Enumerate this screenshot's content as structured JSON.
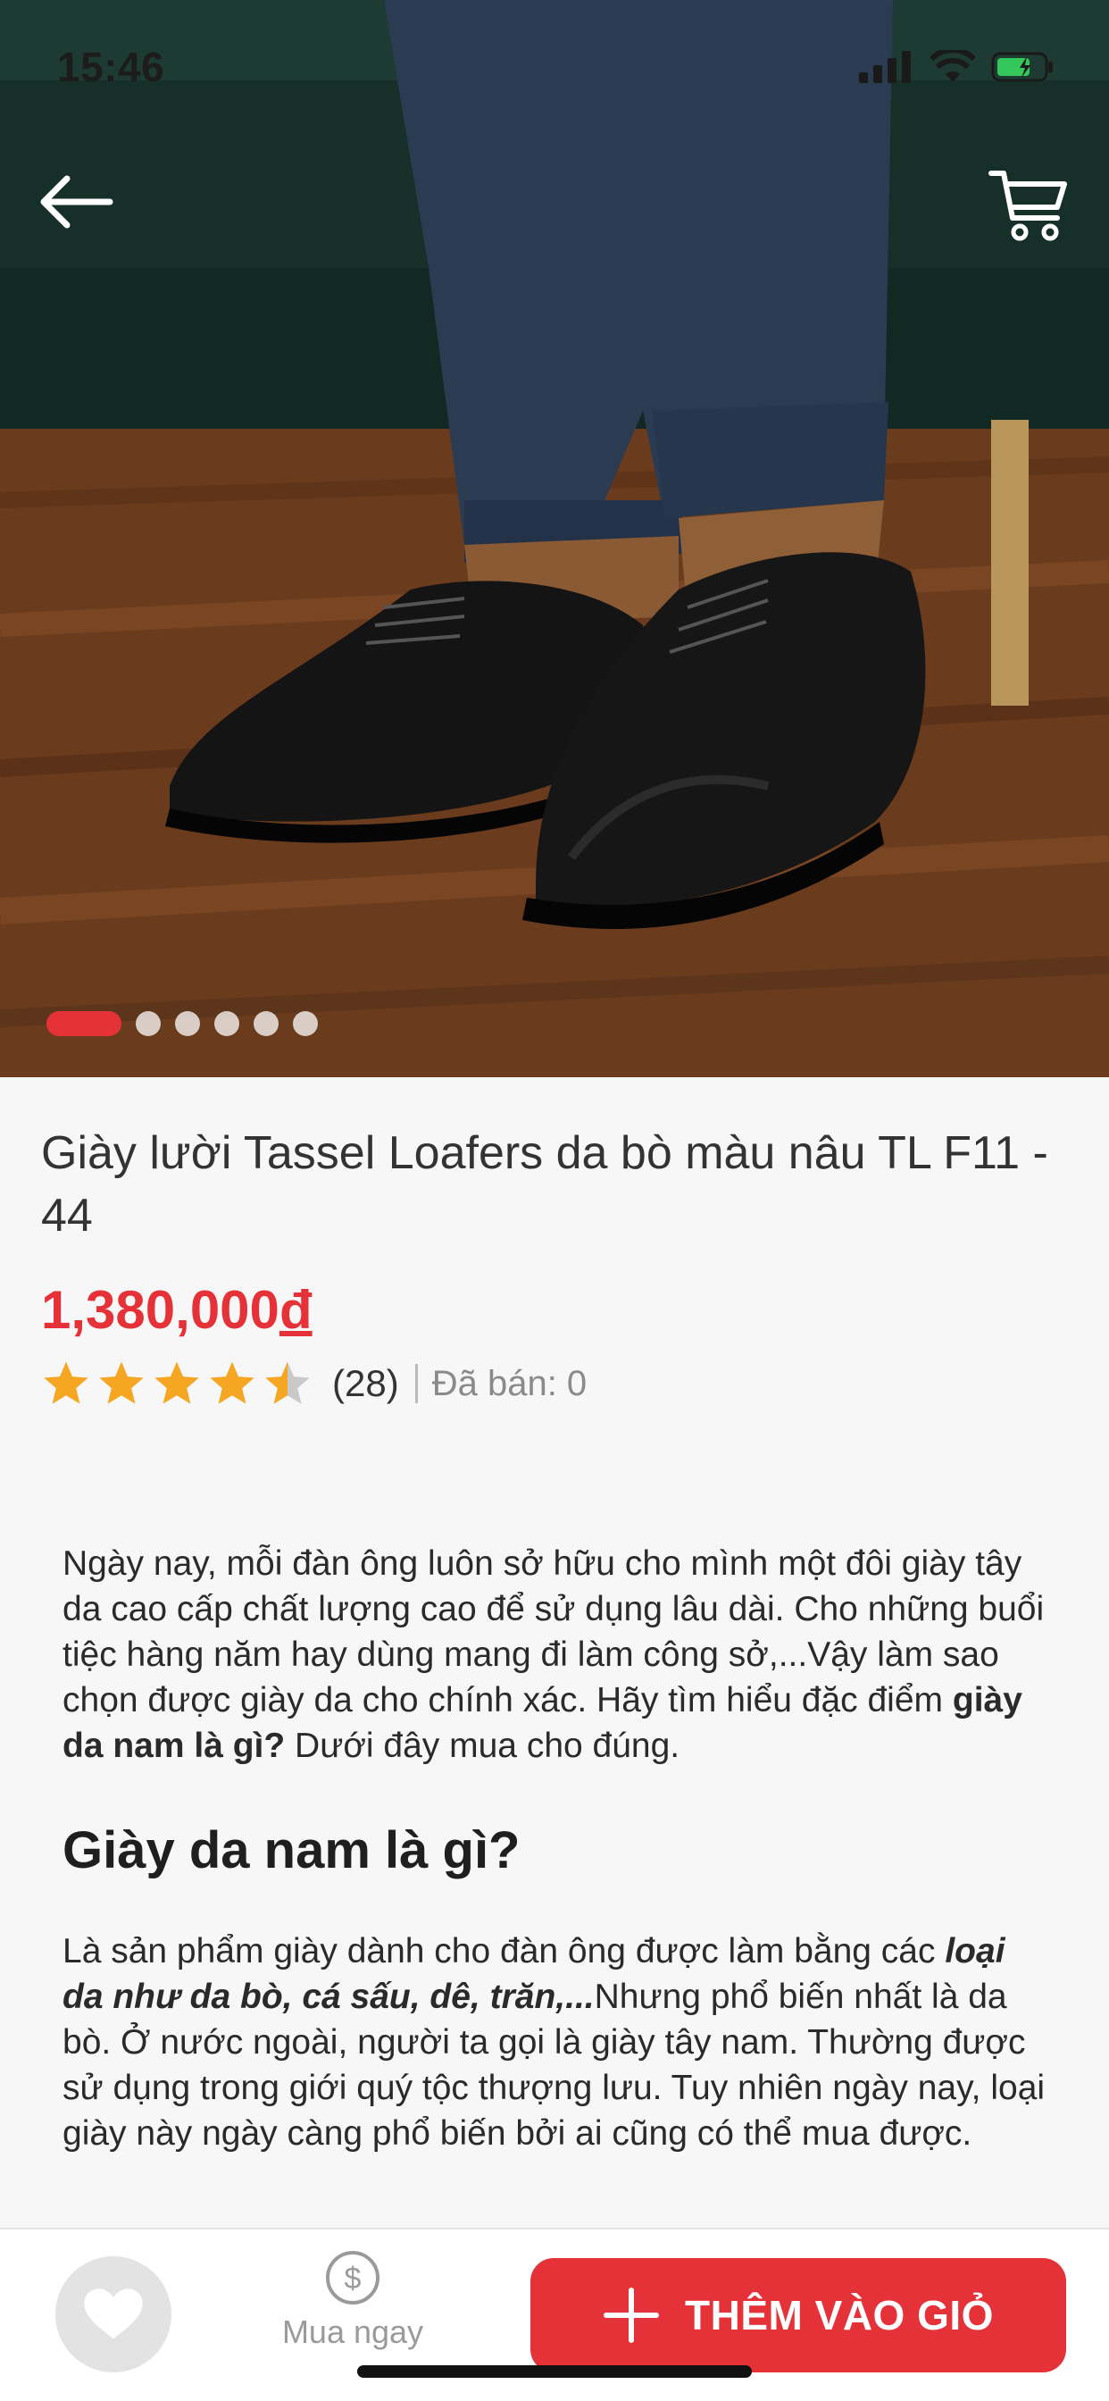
{
  "status_bar": {
    "time": "15:46"
  },
  "header": {
    "back_icon": "arrow-left-icon",
    "cart_icon": "cart-icon"
  },
  "gallery": {
    "total_images": 6,
    "active_index": 0
  },
  "product": {
    "title": "Giày lười Tassel Loafers da bò màu nâu TL F11 - 44",
    "price_value": "1,380,000",
    "price_currency": "đ",
    "rating": 4.5,
    "rating_count": "(28)",
    "sold_label": "Đã bán: 0"
  },
  "description": {
    "p1_text": "Ngày nay, mỗi đàn ông luôn sở hữu cho mình một đôi giày tây da cao cấp chất lượng cao để sử dụng lâu dài. Cho những buổi tiệc hàng năm hay dùng mang đi làm công sở,...Vậy làm sao chọn được giày da cho chính xác. Hãy tìm hiểu đặc điểm ",
    "p1_bold": "giày da nam là gì?",
    "p1_end": " Dưới đây mua cho đúng.",
    "heading": "Giày da nam là gì?",
    "p2_start": "Là sản phẩm giày dành cho đàn ông được làm bằng các ",
    "p2_bold": "loại da như da bò, cá sấu, dê, trăn,...",
    "p2_end": "Nhưng phổ biến nhất là da bò. Ở nước ngoài, người ta gọi là giày tây nam. Thường được sử dụng trong giới quý tộc thượng lưu. Tuy nhiên ngày nay, loại giày này ngày càng phổ biến bởi ai cũng có thể mua được."
  },
  "bottom_bar": {
    "favorite_icon": "heart-icon",
    "buy_now_label": "Mua ngay",
    "buy_now_icon": "dollar-icon",
    "add_to_cart_label": "THÊM VÀO GIỎ",
    "add_to_cart_icon": "plus-icon"
  },
  "colors": {
    "accent": "#e53238",
    "star": "#f5a623"
  }
}
